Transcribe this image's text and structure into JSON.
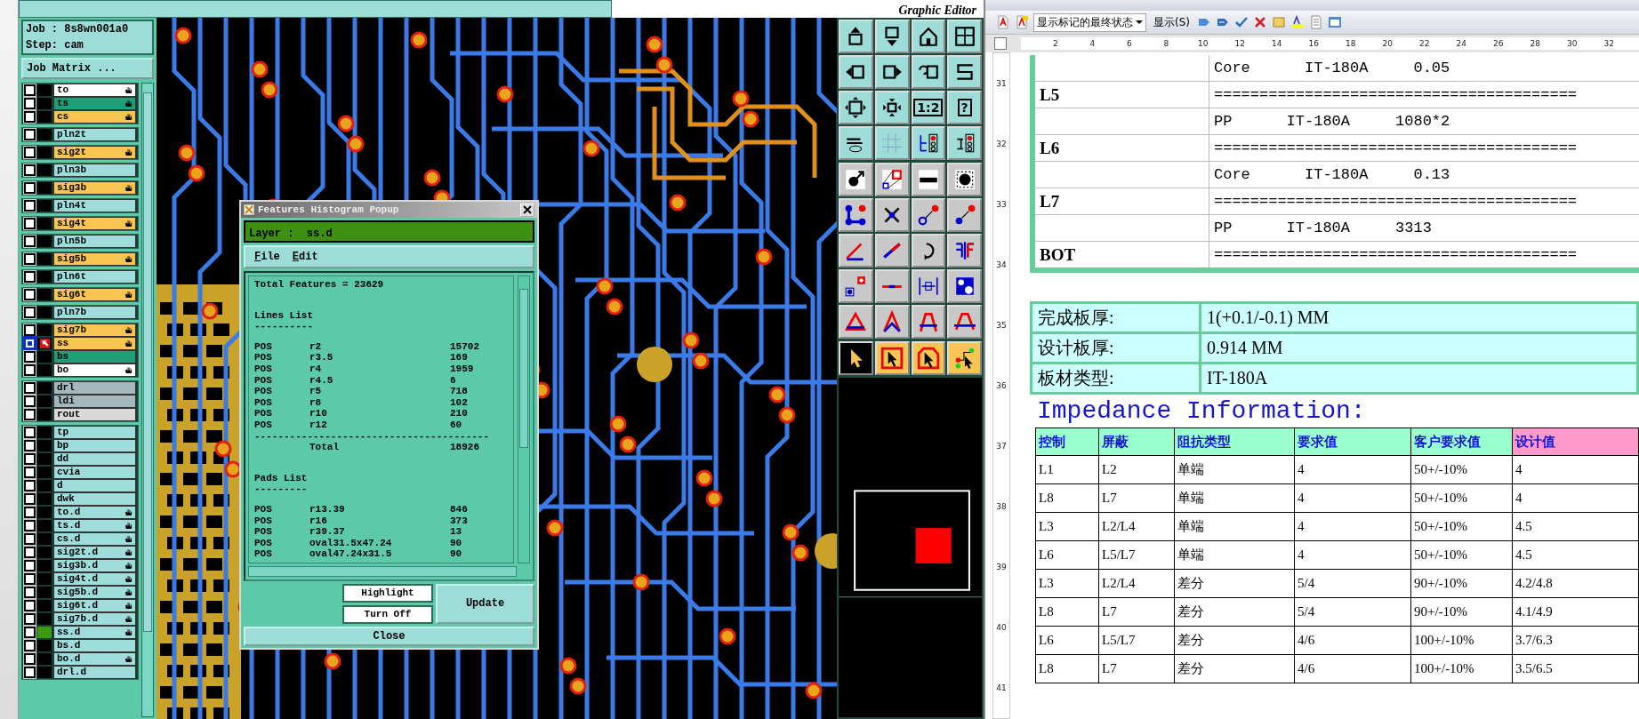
{
  "header": {
    "subtitle": "Graphic Editor"
  },
  "job_panel": {
    "job_label": "Job :",
    "job": "8s8wn001a0",
    "step_label": "Step:",
    "step": "cam",
    "matrix_button": "Job Matrix ...",
    "layer_groups": [
      {
        "layers": [
          {
            "name": "to",
            "color": "#ffffff",
            "hand": true,
            "selected": false,
            "displayed": false
          },
          {
            "name": "ts",
            "color": "#1f9e78",
            "hand": true,
            "selected": false,
            "displayed": false
          },
          {
            "name": "cs",
            "color": "#f8c452",
            "hand": true,
            "selected": false,
            "displayed": false
          }
        ]
      },
      {
        "layers": [
          {
            "name": "pln2t",
            "color": "#9fdcdc",
            "hand": false,
            "selected": false,
            "displayed": false
          }
        ]
      },
      {
        "layers": [
          {
            "name": "sig2t",
            "color": "#f8c452",
            "hand": true,
            "selected": false,
            "displayed": false
          }
        ]
      },
      {
        "layers": [
          {
            "name": "pln3b",
            "color": "#9fdcdc",
            "hand": false,
            "selected": false,
            "displayed": false
          }
        ]
      },
      {
        "layers": [
          {
            "name": "sig3b",
            "color": "#f8c452",
            "hand": true,
            "selected": false,
            "displayed": false
          }
        ]
      },
      {
        "layers": [
          {
            "name": "pln4t",
            "color": "#9fdcdc",
            "hand": false,
            "selected": false,
            "displayed": false
          }
        ]
      },
      {
        "layers": [
          {
            "name": "sig4t",
            "color": "#f8c452",
            "hand": true,
            "selected": false,
            "displayed": false
          }
        ]
      },
      {
        "layers": [
          {
            "name": "pln5b",
            "color": "#9fdcdc",
            "hand": false,
            "selected": false,
            "displayed": false
          }
        ]
      },
      {
        "layers": [
          {
            "name": "sig5b",
            "color": "#f8c452",
            "hand": true,
            "selected": false,
            "displayed": false
          }
        ]
      },
      {
        "layers": [
          {
            "name": "pln6t",
            "color": "#9fdcdc",
            "hand": false,
            "selected": false,
            "displayed": false
          }
        ]
      },
      {
        "layers": [
          {
            "name": "sig6t",
            "color": "#f8c452",
            "hand": true,
            "selected": false,
            "displayed": false
          }
        ]
      },
      {
        "layers": [
          {
            "name": "pln7b",
            "color": "#9fdcdc",
            "hand": false,
            "selected": false,
            "displayed": false
          }
        ]
      },
      {
        "layers": [
          {
            "name": "sig7b",
            "color": "#f8c452",
            "hand": true,
            "selected": false,
            "displayed": false
          },
          {
            "name": "ss",
            "color": "#f8c452",
            "hand": true,
            "selected": true,
            "displayed": false
          },
          {
            "name": "bs",
            "color": "#1f9e78",
            "hand": false,
            "selected": false,
            "displayed": false
          },
          {
            "name": "bo",
            "color": "#ffffff",
            "hand": true,
            "selected": false,
            "displayed": false
          }
        ]
      },
      {
        "layers": [
          {
            "name": "drl",
            "color": "#a3b8bc",
            "hand": false,
            "selected": false,
            "displayed": false
          },
          {
            "name": "ldi",
            "color": "#a3b8bc",
            "hand": false,
            "selected": false,
            "displayed": false
          },
          {
            "name": "rout",
            "color": "#d8d8d8",
            "hand": false,
            "selected": false,
            "displayed": false
          }
        ]
      },
      {
        "layers": [
          {
            "name": "tp",
            "color": "#9fdcdc",
            "hand": false,
            "selected": false,
            "displayed": false
          },
          {
            "name": "bp",
            "color": "#9fdcdc",
            "hand": false,
            "selected": false,
            "displayed": false
          },
          {
            "name": "dd",
            "color": "#9fdcdc",
            "hand": false,
            "selected": false,
            "displayed": false
          },
          {
            "name": "cvia",
            "color": "#9fdcdc",
            "hand": false,
            "selected": false,
            "displayed": false
          },
          {
            "name": "d",
            "color": "#9fdcdc",
            "hand": false,
            "selected": false,
            "displayed": false
          },
          {
            "name": "dwk",
            "color": "#9fdcdc",
            "hand": false,
            "selected": false,
            "displayed": false
          },
          {
            "name": "to.d",
            "color": "#9fdcdc",
            "hand": true,
            "selected": false,
            "displayed": false
          },
          {
            "name": "ts.d",
            "color": "#9fdcdc",
            "hand": true,
            "selected": false,
            "displayed": false
          },
          {
            "name": "cs.d",
            "color": "#9fdcdc",
            "hand": true,
            "selected": false,
            "displayed": false
          },
          {
            "name": "sig2t.d",
            "color": "#9fdcdc",
            "hand": true,
            "selected": false,
            "displayed": false
          },
          {
            "name": "sig3b.d",
            "color": "#9fdcdc",
            "hand": true,
            "selected": false,
            "displayed": false
          },
          {
            "name": "sig4t.d",
            "color": "#9fdcdc",
            "hand": true,
            "selected": false,
            "displayed": false
          },
          {
            "name": "sig5b.d",
            "color": "#9fdcdc",
            "hand": true,
            "selected": false,
            "displayed": false
          },
          {
            "name": "sig6t.d",
            "color": "#9fdcdc",
            "hand": true,
            "selected": false,
            "displayed": false
          },
          {
            "name": "sig7b.d",
            "color": "#9fdcdc",
            "hand": true,
            "selected": false,
            "displayed": false
          },
          {
            "name": "ss.d",
            "color": "#9fdcdc",
            "hand": true,
            "selected": false,
            "displayed": true
          },
          {
            "name": "bs.d",
            "color": "#9fdcdc",
            "hand": false,
            "selected": false,
            "displayed": false
          },
          {
            "name": "bo.d",
            "color": "#9fdcdc",
            "hand": true,
            "selected": false,
            "displayed": false
          },
          {
            "name": "drl.d",
            "color": "#9fdcdc",
            "hand": false,
            "selected": false,
            "displayed": false
          }
        ]
      }
    ]
  },
  "popup": {
    "title": "Features Histogram Popup",
    "layer_label": "Layer :",
    "layer": "ss.d",
    "menu": [
      "File",
      "Edit"
    ],
    "total": "Total Features = 23629",
    "sections": [
      {
        "title": "Lines List",
        "underline": "----------",
        "rows": [
          [
            "POS",
            "r2",
            "15702"
          ],
          [
            "POS",
            "r3.5",
            "169"
          ],
          [
            "POS",
            "r4",
            "1959"
          ],
          [
            "POS",
            "r4.5",
            "6"
          ],
          [
            "POS",
            "r5",
            "718"
          ],
          [
            "POS",
            "r8",
            "102"
          ],
          [
            "POS",
            "r10",
            "210"
          ],
          [
            "POS",
            "r12",
            "60"
          ]
        ],
        "rule": "----------------------------------------",
        "total_label": "Total",
        "total": "18926"
      },
      {
        "title": "Pads List",
        "underline": "---------",
        "rows": [
          [
            "POS",
            "r13.39",
            "846"
          ],
          [
            "POS",
            "r16",
            "373"
          ],
          [
            "POS",
            "r39.37",
            "13"
          ],
          [
            "POS",
            "oval31.5x47.24",
            "90"
          ],
          [
            "POS",
            "oval47.24x31.5",
            "90"
          ]
        ]
      }
    ],
    "buttons": {
      "highlight": "Highlight",
      "turn_off": "Turn Off",
      "update": "Update",
      "close": "Close"
    }
  },
  "toolbox": {
    "groups": [
      {
        "kind": "view",
        "tools": [
          {
            "selected": false
          },
          {
            "selected": false
          },
          {
            "selected": false
          },
          {
            "selected": false
          },
          {
            "selected": false
          },
          {
            "selected": false
          },
          {
            "selected": false
          },
          {
            "selected": false
          },
          {
            "selected": false
          },
          {
            "selected": false
          },
          {
            "selected": false,
            "label": "1:2"
          },
          {
            "selected": false,
            "label": "?"
          },
          {
            "selected": false
          },
          {
            "selected": false
          },
          {
            "selected": false
          },
          {
            "selected": false
          }
        ]
      },
      {
        "kind": "edit",
        "tools": [
          {
            "selected": false
          },
          {
            "selected": false
          },
          {
            "selected": false
          },
          {
            "selected": false
          },
          {
            "selected": false
          },
          {
            "selected": false
          },
          {
            "selected": false
          },
          {
            "selected": false
          },
          {
            "selected": false
          },
          {
            "selected": false
          },
          {
            "selected": false
          },
          {
            "selected": false
          },
          {
            "selected": false
          },
          {
            "selected": false
          },
          {
            "selected": false
          },
          {
            "selected": false
          },
          {
            "selected": false
          },
          {
            "selected": false
          },
          {
            "selected": false
          },
          {
            "selected": false
          }
        ]
      },
      {
        "kind": "select",
        "tools": [
          {
            "selected": true
          },
          {
            "selected": false
          },
          {
            "selected": false
          },
          {
            "selected": false
          }
        ]
      }
    ]
  },
  "word": {
    "markup_dropdown": "显示标记的最终状态",
    "show_menu": "显示(S)",
    "ruler_h": [
      "2",
      "4",
      "6",
      "8",
      "10",
      "12",
      "14",
      "16",
      "18",
      "20",
      "22",
      "24",
      "26",
      "28",
      "30",
      "32"
    ],
    "ruler_v": [
      "31",
      "32",
      "33",
      "34",
      "35",
      "36",
      "37",
      "38",
      "39",
      "40",
      "41"
    ],
    "stack_rows": [
      {
        "label": "",
        "text": "Core      IT-180A     0.05"
      },
      {
        "label": "L5",
        "text": "========================================"
      },
      {
        "label": "",
        "text": "PP      IT-180A     1080*2"
      },
      {
        "label": "L6",
        "text": "========================================"
      },
      {
        "label": "",
        "text": "Core      IT-180A     0.13"
      },
      {
        "label": "L7",
        "text": "========================================"
      },
      {
        "label": "",
        "text": "PP      IT-180A     3313"
      },
      {
        "label": "BOT",
        "text": "========================================"
      }
    ],
    "info_rows": [
      [
        "完成板厚:",
        "1(+0.1/-0.1) MM"
      ],
      [
        "设计板厚:",
        "0.914 MM"
      ],
      [
        "板材类型:",
        "IT-180A"
      ]
    ],
    "heading": "Impedance Information:",
    "impedance_columns": [
      {
        "label": "控制",
        "color": "#99ffcc"
      },
      {
        "label": "屏蔽",
        "color": "#99ffcc"
      },
      {
        "label": "阻抗类型",
        "color": "#99ffcc"
      },
      {
        "label": "要求值",
        "color": "#99ffcc"
      },
      {
        "label": "客户要求值",
        "color": "#99ffcc"
      },
      {
        "label": "设计值",
        "color": "#ff99cc"
      }
    ],
    "impedance_rows": [
      [
        "L1",
        "L2",
        "单端",
        "4",
        "50+/-10%",
        "4"
      ],
      [
        "L8",
        "L7",
        "单端",
        "4",
        "50+/-10%",
        "4"
      ],
      [
        "L3",
        "L2/L4",
        "单端",
        "4",
        "50+/-10%",
        "4.5"
      ],
      [
        "L6",
        "L5/L7",
        "单端",
        "4",
        "50+/-10%",
        "4.5"
      ],
      [
        "L3",
        "L2/L4",
        "差分",
        "5/4",
        "90+/-10%",
        "4.2/4.8"
      ],
      [
        "L8",
        "L7",
        "差分",
        "5/4",
        "90+/-10%",
        "4.1/4.9"
      ],
      [
        "L6",
        "L5/L7",
        "差分",
        "4/6",
        "100+/-10%",
        "3.7/6.3"
      ],
      [
        "L8",
        "L7",
        "差分",
        "4/6",
        "100+/-10%",
        "3.5/6.5"
      ]
    ]
  }
}
